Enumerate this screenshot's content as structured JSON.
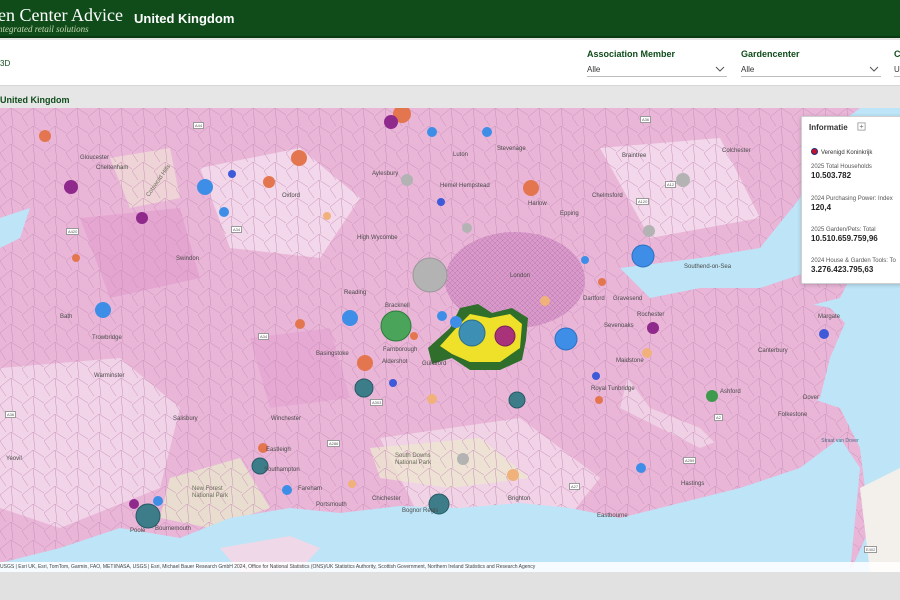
{
  "header": {
    "brand": "en Center Advice",
    "brand_sub": "ntegrated retail solutions",
    "region": "United Kingdom"
  },
  "filters": {
    "left_label": "3D",
    "items": [
      {
        "label": "Association Member",
        "value": "Alle"
      },
      {
        "label": "Gardencenter",
        "value": "Alle"
      },
      {
        "label": "Co",
        "value": "U"
      }
    ]
  },
  "map": {
    "title": "United Kingdom",
    "places": [
      "Gloucester",
      "Cheltenham",
      "Oxford",
      "Aylesbury",
      "Hemel Hempstead",
      "Luton",
      "Stevenage",
      "Braintree",
      "Colchester",
      "Chelmsford",
      "Epping",
      "Harlow",
      "High Wycombe",
      "Swindon",
      "London",
      "Southend-on-Sea",
      "Bath",
      "Reading",
      "Bracknell",
      "Gravesend",
      "Dartford",
      "Trowbridge",
      "Basingstoke",
      "Aldershot",
      "Farnborough",
      "Guildford",
      "Sevenoaks",
      "Rochester",
      "Margate",
      "Canterbury",
      "Warminster",
      "Royal Tunbridge",
      "Maidstone",
      "Winchester",
      "Salisbury",
      "Ashford",
      "Dover",
      "Folkestone",
      "Yeovil",
      "Eastleigh",
      "Southampton",
      "Fareham",
      "Portsmouth",
      "Chichester",
      "Bognor Regis",
      "Brighton",
      "Eastbourne",
      "Poole",
      "Bournemouth",
      "Hastings"
    ],
    "seas": [
      "Straat van Dover"
    ],
    "roads": [
      "A44",
      "A10",
      "A4",
      "A419",
      "A34",
      "A420",
      "A303",
      "A27",
      "A259",
      "A21",
      "A2",
      "E402",
      "A120",
      "A12",
      "A130",
      "A1017",
      "A31",
      "A286",
      "A299",
      "A36"
    ],
    "parks": [
      "Cotswold Hills",
      "New Forest National Park",
      "South Downs National Park"
    ],
    "attribution": "USGS | Esri UK, Esri, TomTom, Garmin, FAO, METI/NASA, USGS | Esri, Michael Bauer Research GmbH 2024, Office for National Statistics (ONS)/UK Statistics Authority, Scottish Government, Northern Ireland Statistics and Research Agency"
  },
  "info_panel": {
    "title": "Informatie",
    "country": "Verenigd Koninkrijk",
    "metrics": [
      {
        "label": "2025 Total Households",
        "value": "10.503.782"
      },
      {
        "label": "2024 Purchasing Power: Index",
        "value": "120,4"
      },
      {
        "label": "2025 Garden/Pets: Total",
        "value": "10.510.659.759,96"
      },
      {
        "label": "2024 House & Garden Tools: To",
        "value": "3.276.423.795,63"
      }
    ]
  },
  "colors": {
    "header_green": "#0f4c1a",
    "land_pink": "#e9b6d8",
    "sea_blue": "#bde5f7",
    "highlight_yellow": "#f0e12a",
    "highlight_green": "#5aa03c"
  }
}
